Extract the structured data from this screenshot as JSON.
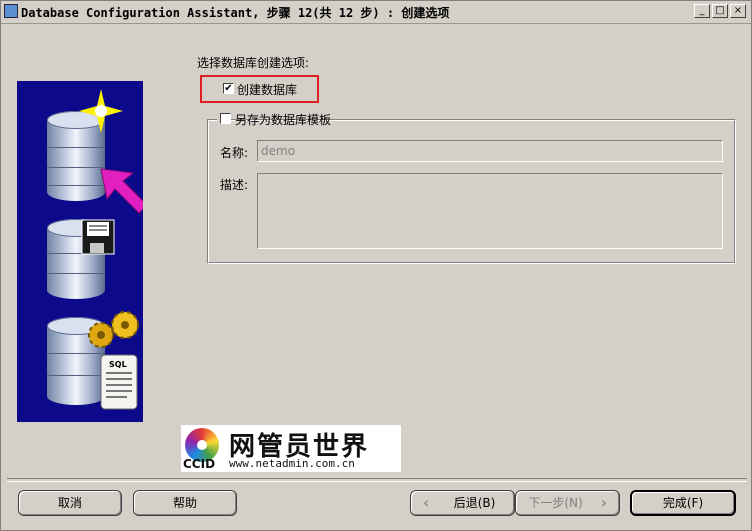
{
  "window": {
    "title": "Database Configuration Assistant, 步骤 12(共 12 步) : 创建选项",
    "controls": {
      "minimize": "_",
      "maximize": "□",
      "close": "×"
    }
  },
  "options": {
    "heading": "选择数据库创建选项:",
    "create_database": {
      "label": "创建数据库",
      "checked": true,
      "mark": "✔"
    },
    "save_as_template": {
      "label": "另存为数据库模板",
      "checked": false
    }
  },
  "template_form": {
    "name_label": "名称:",
    "name_value": "demo",
    "description_label": "描述:",
    "description_value": ""
  },
  "watermark": {
    "brand": "CCID",
    "cn_text": "网管员世界",
    "url": "www.netadmin.com.cn"
  },
  "buttons": {
    "cancel": "取消",
    "help": "帮助",
    "back": "后退(B)",
    "back_icon": "‹",
    "next": "下一步(N)",
    "next_icon": "›",
    "finish": "完成(F)"
  },
  "colors": {
    "dialog_bg": "#d4d0c8",
    "side_image_bg": "#0c0a8a",
    "highlight_box": "#e02020",
    "arrow": "#e020c0"
  }
}
